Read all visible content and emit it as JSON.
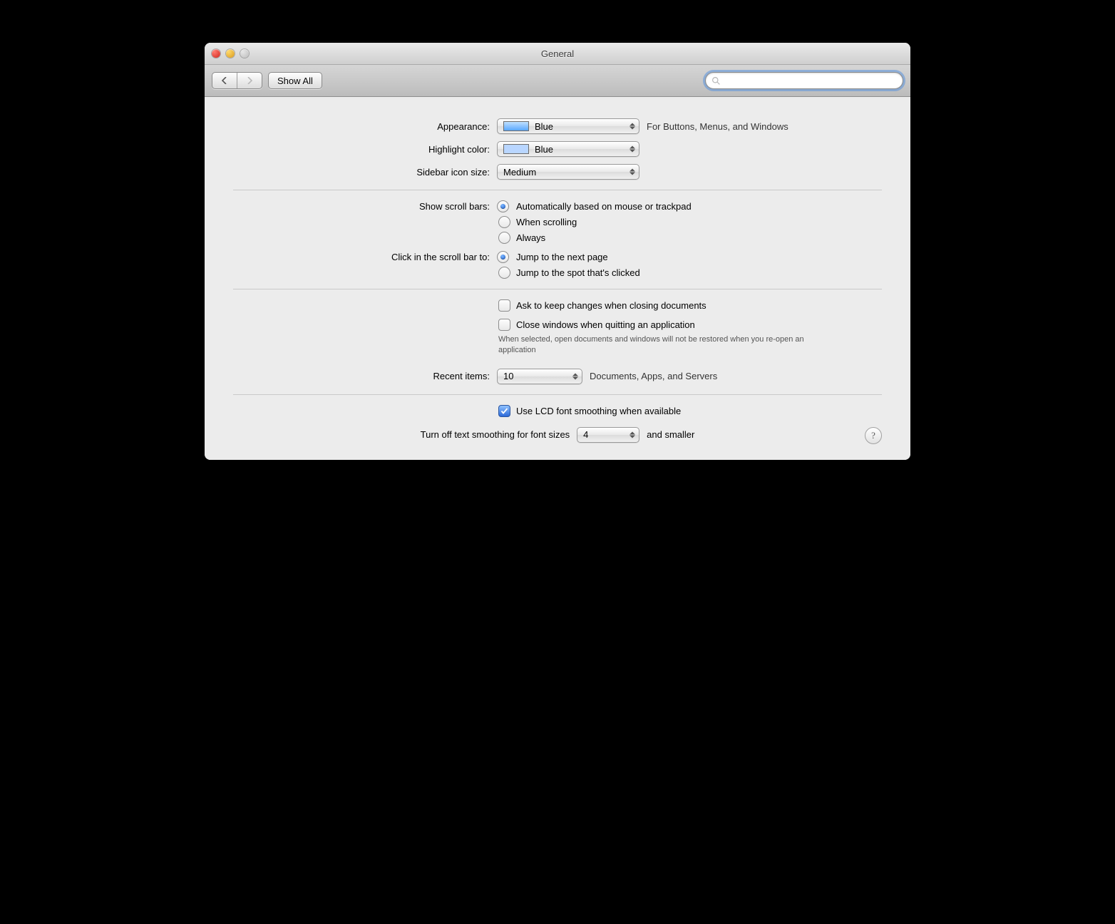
{
  "window": {
    "title": "General"
  },
  "toolbar": {
    "show_all": "Show All",
    "search_placeholder": ""
  },
  "appearance": {
    "label": "Appearance:",
    "value": "Blue",
    "swatch": "#7fc2ff",
    "hint": "For Buttons, Menus, and Windows"
  },
  "highlight": {
    "label": "Highlight color:",
    "value": "Blue",
    "swatch": "#b9d6ff"
  },
  "sidebar_icon": {
    "label": "Sidebar icon size:",
    "value": "Medium"
  },
  "scrollbars": {
    "label": "Show scroll bars:",
    "options": [
      "Automatically based on mouse or trackpad",
      "When scrolling",
      "Always"
    ],
    "selected": 0
  },
  "scrollclick": {
    "label": "Click in the scroll bar to:",
    "options": [
      "Jump to the next page",
      "Jump to the spot that's clicked"
    ],
    "selected": 0
  },
  "ask_keep_changes": {
    "label": "Ask to keep changes when closing documents",
    "checked": false
  },
  "close_windows_quit": {
    "label": "Close windows when quitting an application",
    "checked": false,
    "sub": "When selected, open documents and windows will not be restored when you re-open an application"
  },
  "recent_items": {
    "label": "Recent items:",
    "value": "10",
    "suffix": "Documents, Apps, and Servers"
  },
  "lcd_smoothing": {
    "label": "Use LCD font smoothing when available",
    "checked": true
  },
  "smoothing_cutoff": {
    "prefix": "Turn off text smoothing for font sizes",
    "value": "4",
    "suffix": "and smaller"
  },
  "help": "?"
}
